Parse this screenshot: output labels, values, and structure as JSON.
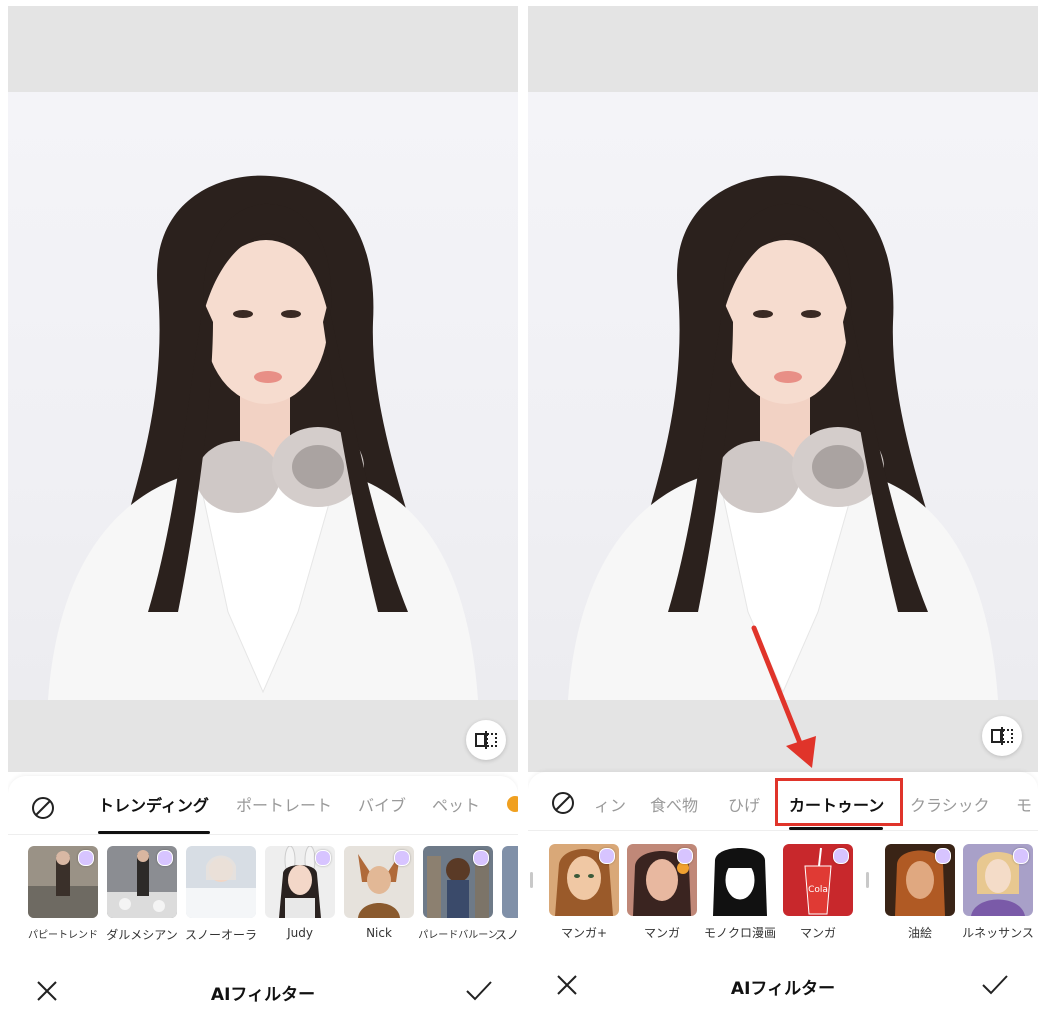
{
  "app": {
    "title": "AIフィルター"
  },
  "left": {
    "tabs": [
      "トレンディング",
      "ポートレート",
      "バイブ",
      "ペット"
    ],
    "active_tab": "トレンディング",
    "filters": [
      {
        "label": "パピートレンド",
        "premium": true
      },
      {
        "label": "ダルメシアン",
        "premium": true
      },
      {
        "label": "スノーオーラ",
        "premium": false
      },
      {
        "label": "Judy",
        "premium": true
      },
      {
        "label": "Nick",
        "premium": true
      },
      {
        "label": "パレードバルーン",
        "premium": true
      },
      {
        "label": "スノ",
        "premium": false
      }
    ]
  },
  "right": {
    "tabs": [
      "ィン",
      "食べ物",
      "ひげ",
      "カートゥーン",
      "クラシック",
      "モ"
    ],
    "active_tab": "カートゥーン",
    "filters": [
      {
        "label": "マンガ+",
        "premium": true
      },
      {
        "label": "マンガ",
        "premium": true
      },
      {
        "label": "モノクロ漫画",
        "premium": false
      },
      {
        "label": "マンガ",
        "premium": true
      },
      {
        "label": "油絵",
        "premium": true
      },
      {
        "label": "ルネッサンス",
        "premium": true
      }
    ]
  },
  "icons": {
    "none": "no-filter-icon",
    "compare": "compare-icon",
    "close": "close-icon",
    "confirm": "checkmark-icon",
    "premium": "gem-icon"
  },
  "colors": {
    "accent_highlight": "#e0342a",
    "active_tab": "#111111",
    "inactive_tab": "#9a9a9a",
    "canvas_bg": "#e4e4e4"
  }
}
